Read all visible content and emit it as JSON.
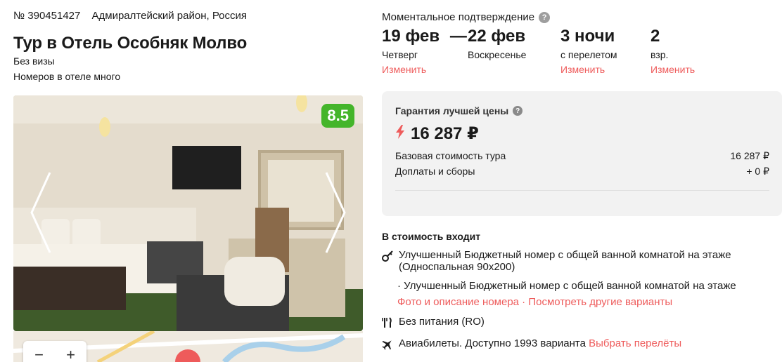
{
  "hotel": {
    "id_label": "№ 390451427",
    "location": "Адмиралтейский район, Россия",
    "title": "Тур в Отель Особняк Молво",
    "visa": "Без визы",
    "rooms_note": "Номеров в отеле много",
    "rating": "8.5"
  },
  "map": {
    "zoom_out": "−",
    "zoom_in": "+"
  },
  "booking": {
    "instant_confirm": "Моментальное подтверждение",
    "help_glyph": "?",
    "date_from": "19 фев",
    "date_sep": "—",
    "date_to": "22 фев",
    "day_from": "Четверг",
    "day_to": "Воскресенье",
    "change_dates": "Изменить",
    "nights": "3 ночи",
    "nights_note": "с перелетом",
    "change_nights": "Изменить",
    "adults": "2",
    "adults_note": "взр.",
    "change_adults": "Изменить"
  },
  "price": {
    "guarantee": "Гарантия лучшей цены",
    "total": "16 287 ₽",
    "base_label": "Базовая стоимость тура",
    "base_value": "16 287 ₽",
    "fees_label": "Доплаты и сборы",
    "fees_value": "+ 0 ₽"
  },
  "included": {
    "title": "В стоимость входит",
    "room_line1": "Улучшенный Бюджетный номер с общей ванной комнатой на этаже",
    "room_line2": "(Односпальная 90х200)",
    "room_alt": "· Улучшенный Бюджетный номер с общей ванной комнатой на этаже",
    "room_photos_link": "Фото и описание номера",
    "links_sep": " · ",
    "room_other_link": "Посмотреть другие варианты",
    "meals": "Без питания (RO)",
    "flights": "Авиабилеты. Доступно 1993 варианта",
    "flights_link": "Выбрать перелёты"
  },
  "icons": {
    "help": "help-circle-icon",
    "lightning": "lightning-icon",
    "key": "key-icon",
    "cutlery": "cutlery-icon",
    "plane": "plane-icon",
    "arrow_left": "chevron-left-icon",
    "arrow_right": "chevron-right-icon"
  },
  "colors": {
    "accent_red": "#ee5b5b",
    "rating_green": "#44b52a",
    "card_bg": "#f2f2f2"
  }
}
